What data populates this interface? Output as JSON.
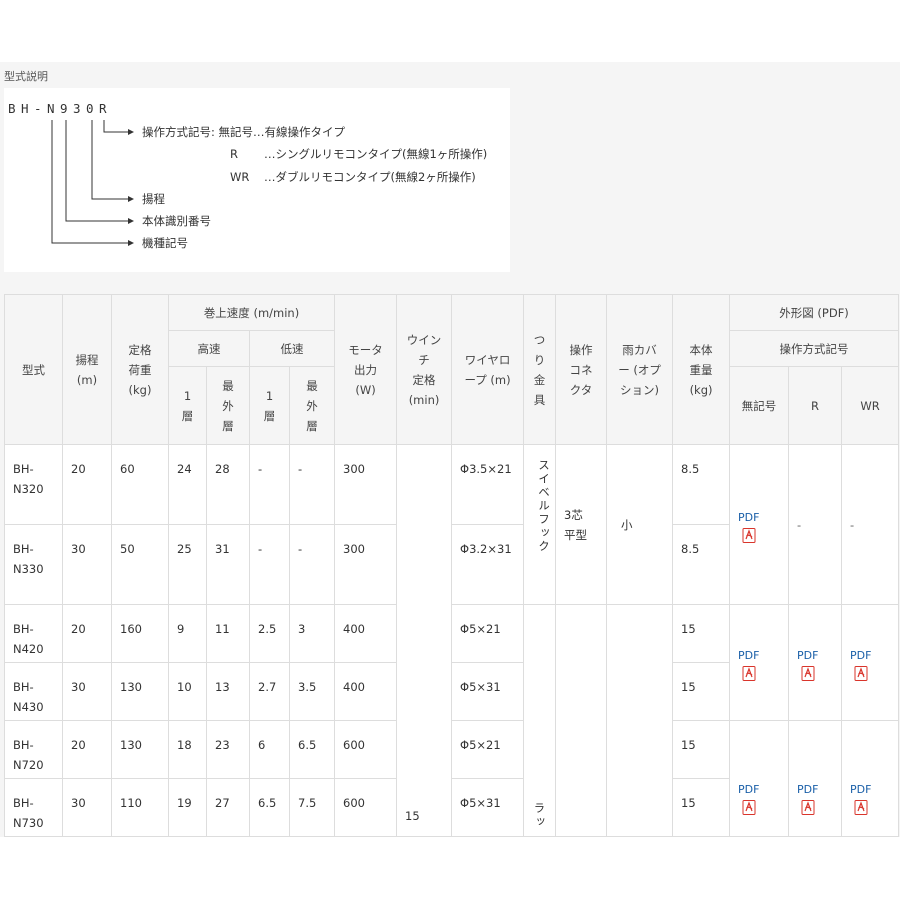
{
  "section_title": "型式説明",
  "model_code": {
    "chars": [
      "B",
      "H",
      "-",
      "N",
      "9",
      "3",
      "0",
      "R"
    ],
    "operation_label": "操作方式記号: 無記号…有線操作タイプ",
    "option_r_code": "R",
    "option_r_desc": "…シングルリモコンタイプ(無線1ヶ所操作)",
    "option_wr_code": "WR",
    "option_wr_desc": "…ダブルリモコンタイプ(無線2ヶ所操作)",
    "lift_label": "揚程",
    "body_label": "本体識別番号",
    "type_label": "機種記号"
  },
  "table": {
    "headers": {
      "model": "型式",
      "lift": "揚程\n(m)",
      "load": "定格\n荷重\n(kg)",
      "speed": "巻上速度 (m/min)",
      "high": "高速",
      "low": "低速",
      "layer1": "1\n層",
      "outer": "最\n外\n層",
      "motor": "モータ\n出力\n(W)",
      "winch": "ウイン\nチ\n定格\n(min)",
      "wire": "ワイヤロ\nープ (m)",
      "hook": "つ\nり\n金\n具",
      "connector": "操作\nコネ\nクタ",
      "cover": "雨カバ\nー (オプ\nション)",
      "weight": "本体\n重量\n(kg)",
      "outline": "外形図 (PDF)",
      "op_symbol": "操作方式記号",
      "op_none": "無記号",
      "op_r": "R",
      "op_wr": "WR"
    },
    "rows": [
      {
        "model": "BH-\nN320",
        "lift": "20",
        "load": "60",
        "h1": "24",
        "hout": "28",
        "l1": "-",
        "lout": "-",
        "motor": "300",
        "wire": "Φ3.5×21",
        "weight": "8.5"
      },
      {
        "model": "BH-\nN330",
        "lift": "30",
        "load": "50",
        "h1": "25",
        "hout": "31",
        "l1": "-",
        "lout": "-",
        "motor": "300",
        "wire": "Φ3.2×31",
        "weight": "8.5"
      },
      {
        "model": "BH-\nN420",
        "lift": "20",
        "load": "160",
        "h1": "9",
        "hout": "11",
        "l1": "2.5",
        "lout": "3",
        "motor": "400",
        "wire": "Φ5×21",
        "weight": "15"
      },
      {
        "model": "BH-\nN430",
        "lift": "30",
        "load": "130",
        "h1": "10",
        "hout": "13",
        "l1": "2.7",
        "lout": "3.5",
        "motor": "400",
        "wire": "Φ5×31",
        "weight": "15"
      },
      {
        "model": "BH-\nN720",
        "lift": "20",
        "load": "130",
        "h1": "18",
        "hout": "23",
        "l1": "6",
        "lout": "6.5",
        "motor": "600",
        "wire": "Φ5×21",
        "weight": "15"
      },
      {
        "model": "BH-\nN730",
        "lift": "30",
        "load": "110",
        "h1": "19",
        "hout": "27",
        "l1": "6.5",
        "lout": "7.5",
        "motor": "600",
        "wire": "Φ5×31",
        "weight": "15"
      }
    ],
    "winch_value": "15",
    "hook_swivel": "スイベルフック",
    "hook_latch": "ラッ",
    "connector_value": "3芯\n平型",
    "cover_value": "小",
    "pdf_label": "PDF",
    "dash": "-"
  },
  "colors": {
    "pdf_link": "#1a5fa8",
    "pdf_icon": "#d9342b",
    "header_bg": "#f5f5f5",
    "border": "#dddddd"
  }
}
